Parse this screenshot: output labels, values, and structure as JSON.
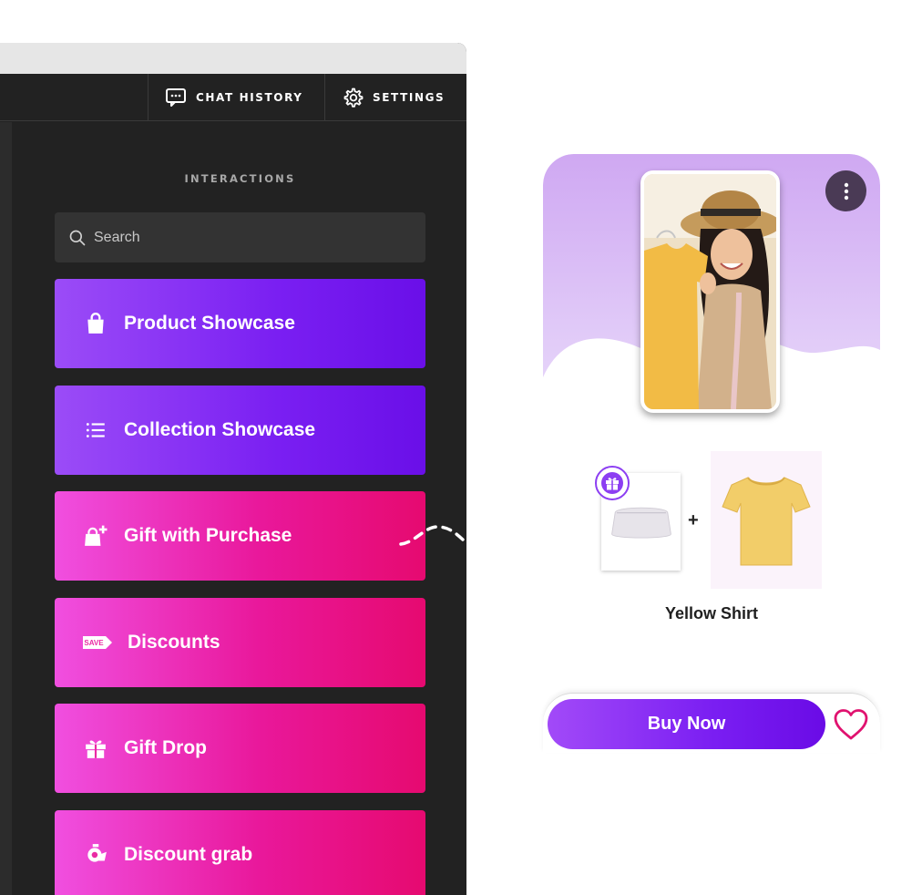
{
  "toolbar": {
    "chat_history_label": "CHAT HISTORY",
    "settings_label": "SETTINGS"
  },
  "panel": {
    "title": "INTERACTIONS",
    "search_placeholder": "Search",
    "items": [
      {
        "label": "Product Showcase",
        "icon": "shopping-bag-icon",
        "style": "purple"
      },
      {
        "label": "Collection Showcase",
        "icon": "list-icon",
        "style": "purple"
      },
      {
        "label": "Gift with Purchase",
        "icon": "gift-bag-plus-icon",
        "style": "pink"
      },
      {
        "label": "Discounts",
        "icon": "save-tag-icon",
        "style": "pink"
      },
      {
        "label": "Gift Drop",
        "icon": "gift-icon",
        "style": "pink"
      },
      {
        "label": "Discount grab",
        "icon": "grab-claw-icon",
        "style": "pink"
      }
    ]
  },
  "preview": {
    "product_name": "Yellow Shirt",
    "buy_label": "Buy Now",
    "save_tag_text": "SAVE"
  },
  "colors": {
    "accent_purple": "#7a1ff2",
    "accent_pink": "#e9189b",
    "panel_bg": "#222222"
  }
}
